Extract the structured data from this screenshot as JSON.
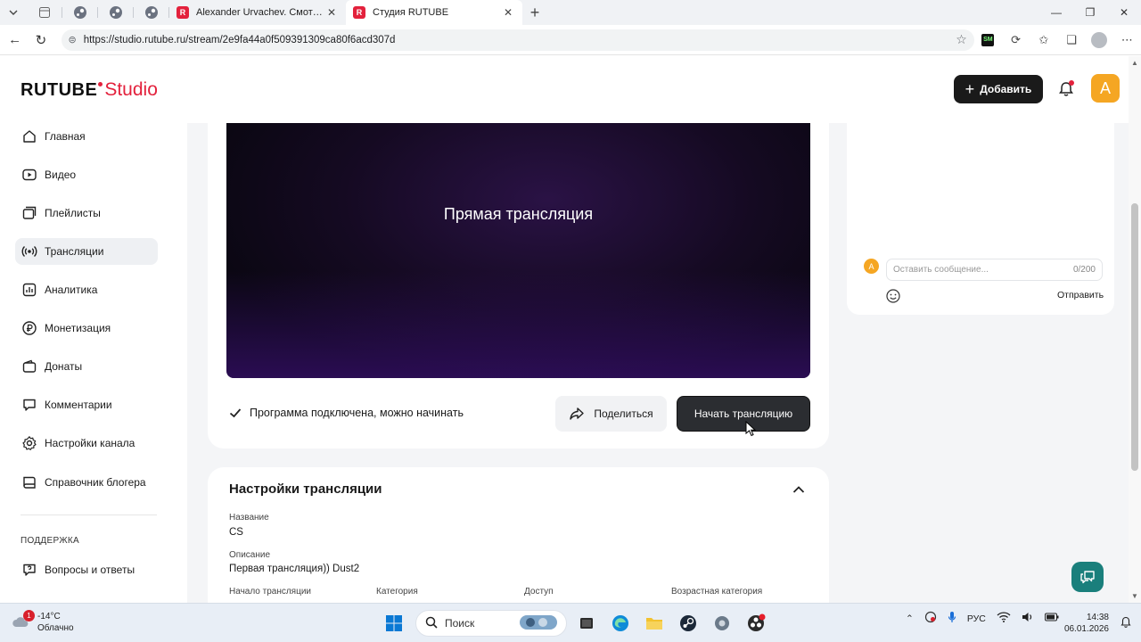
{
  "browser": {
    "tabs": [
      {
        "title": "Alexander Urvachev. Смотрите ви"
      },
      {
        "title": "Студия RUTUBE"
      }
    ],
    "tab_favicon": "R",
    "url": "https://studio.rutube.ru/stream/2e9fa44a0f509391309ca80f6acd307d"
  },
  "header": {
    "logo_main": "RUTUBE",
    "logo_sub": "Studio",
    "add_button": "Добавить",
    "avatar_letter": "A"
  },
  "sidebar": {
    "items": [
      {
        "label": "Главная",
        "icon": "home-icon"
      },
      {
        "label": "Видео",
        "icon": "video-icon"
      },
      {
        "label": "Плейлисты",
        "icon": "playlist-icon"
      },
      {
        "label": "Трансляции",
        "icon": "broadcast-icon"
      },
      {
        "label": "Аналитика",
        "icon": "analytics-icon"
      },
      {
        "label": "Монетизация",
        "icon": "ruble-icon"
      },
      {
        "label": "Донаты",
        "icon": "wallet-icon"
      },
      {
        "label": "Комментарии",
        "icon": "comment-icon"
      },
      {
        "label": "Настройки канала",
        "icon": "gear-icon"
      },
      {
        "label": "Справочник блогера",
        "icon": "book-icon"
      }
    ],
    "active_index": 3,
    "support_section": "ПОДДЕРЖКА",
    "support_items": [
      {
        "label": "Вопросы и ответы",
        "icon": "question-icon"
      }
    ]
  },
  "stream": {
    "player_title": "Прямая трансляция",
    "status_text": "Программа подключена, можно начинать",
    "share_button": "Поделиться",
    "start_button": "Начать трансляцию"
  },
  "settings": {
    "title": "Настройки трансляции",
    "name_label": "Название",
    "name_value": "CS",
    "description_label": "Описание",
    "description_value": "Первая трансляция)) Dust2",
    "columns": [
      "Начало трансляции",
      "Категория",
      "Доступ",
      "Возрастная категория"
    ]
  },
  "chat": {
    "avatar_letter": "A",
    "input_placeholder": "Оставить сообщение...",
    "counter": "0/200",
    "send_button": "Отправить"
  },
  "taskbar": {
    "weather_badge": "1",
    "temperature": "-14°C",
    "weather_desc": "Облачно",
    "search_label": "Поиск",
    "language": "РУС",
    "time": "14:38",
    "date": "06.01.2026"
  },
  "colors": {
    "brand_red": "#e3213c",
    "avatar_orange": "#f5a623",
    "dark_button": "#2b2d31",
    "support_teal": "#1a7f7c"
  }
}
